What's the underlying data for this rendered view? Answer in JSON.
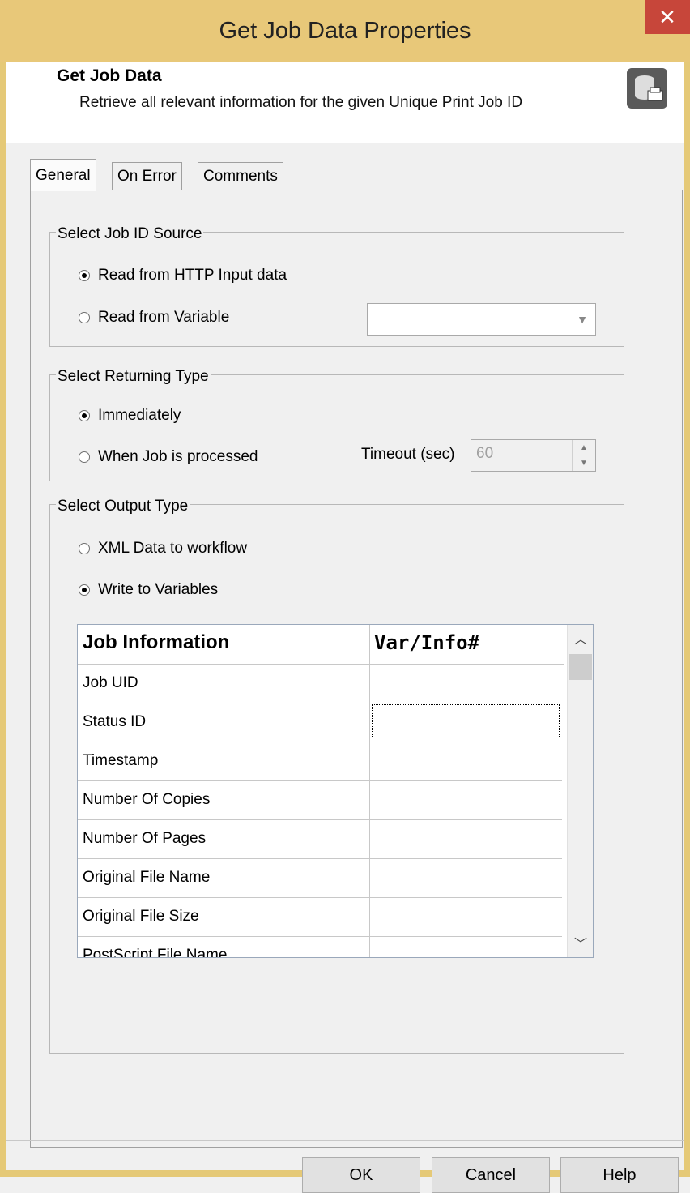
{
  "window": {
    "title": "Get Job Data Properties",
    "close_glyph": "✕"
  },
  "header": {
    "title": "Get Job Data",
    "description": "Retrieve all relevant information for the given Unique Print Job ID",
    "icon": "database-printer-icon"
  },
  "tabs": [
    {
      "label": "General",
      "active": true
    },
    {
      "label": "On Error",
      "active": false
    },
    {
      "label": "Comments",
      "active": false
    }
  ],
  "job_id_source": {
    "legend": "Select Job ID Source",
    "options": [
      {
        "label": "Read from HTTP Input data",
        "selected": true
      },
      {
        "label": "Read from Variable",
        "selected": false
      }
    ],
    "variable_combo_value": ""
  },
  "returning_type": {
    "legend": "Select Returning Type",
    "options": [
      {
        "label": "Immediately",
        "selected": true
      },
      {
        "label": "When Job is processed",
        "selected": false
      }
    ],
    "timeout_label": "Timeout (sec)",
    "timeout_value": "60"
  },
  "output_type": {
    "legend": "Select Output Type",
    "options": [
      {
        "label": "XML Data to workflow",
        "selected": false
      },
      {
        "label": "Write to Variables",
        "selected": true
      }
    ]
  },
  "grid": {
    "columns": [
      "Job Information",
      "Var/Info#"
    ],
    "rows": [
      {
        "info": "Job UID",
        "var": ""
      },
      {
        "info": "Status ID",
        "var": ""
      },
      {
        "info": "Timestamp",
        "var": ""
      },
      {
        "info": "Number Of Copies",
        "var": ""
      },
      {
        "info": "Number Of Pages",
        "var": ""
      },
      {
        "info": "Original File Name",
        "var": ""
      },
      {
        "info": "Original File Size",
        "var": ""
      },
      {
        "info": "PostScript File Name",
        "var": ""
      }
    ]
  },
  "buttons": {
    "ok": "OK",
    "cancel": "Cancel",
    "help": "Help"
  }
}
